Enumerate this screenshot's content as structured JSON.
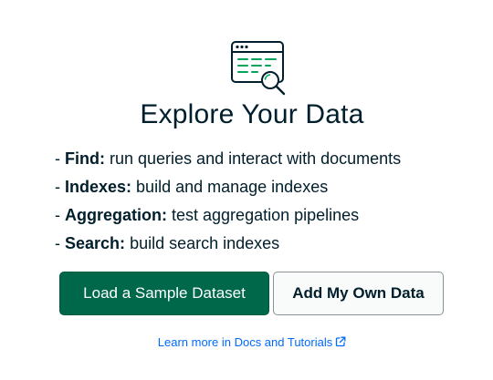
{
  "empty_state": {
    "illustration_icon": "table-with-magnifier-icon",
    "title": "Explore Your Data",
    "features": [
      {
        "term": "Find:",
        "description": "run queries and interact with documents"
      },
      {
        "term": "Indexes:",
        "description": "build and manage indexes"
      },
      {
        "term": "Aggregation:",
        "description": "test aggregation pipelines"
      },
      {
        "term": "Search:",
        "description": "build search indexes"
      }
    ],
    "primary_button": "Load a Sample Dataset",
    "secondary_button": "Add My Own Data",
    "learn_more_link": "Learn more in Docs and Tutorials",
    "learn_more_icon": "external-link-icon",
    "colors": {
      "primary_green": "#00684a",
      "illustration_green": "#00ed64",
      "text_dark": "#001e2b",
      "link_blue": "#016bf8"
    }
  }
}
